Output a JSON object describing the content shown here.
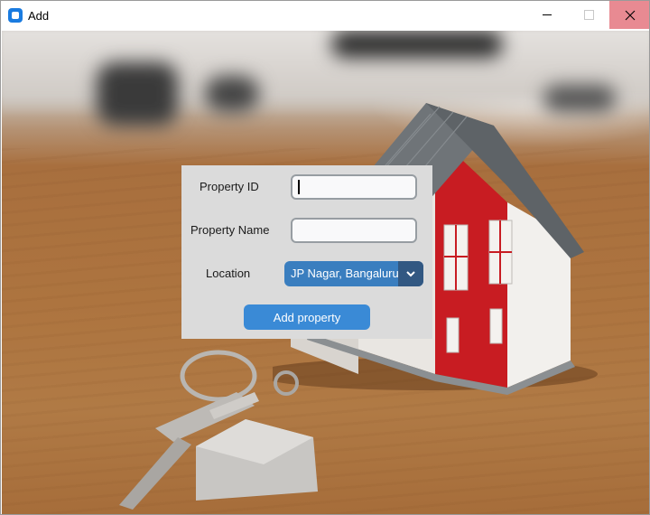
{
  "window": {
    "title": "Add",
    "icons": {
      "app": "app-icon",
      "minimize": "minimize-icon",
      "maximize": "maximize-icon",
      "close": "close-icon"
    },
    "close_hover_color": "#e88a92"
  },
  "form": {
    "panel_color": "#dbdbdb",
    "property_id": {
      "label": "Property ID",
      "value": ""
    },
    "property_name": {
      "label": "Property Name",
      "value": ""
    },
    "location": {
      "label": "Location",
      "selected": "JP Nagar, Bangaluru",
      "dropdown_icon": "chevron-down-icon"
    },
    "submit_label": "Add property",
    "accent_color": "#3a7ebf"
  },
  "background": {
    "description_icon": "house-with-keys-photo"
  }
}
